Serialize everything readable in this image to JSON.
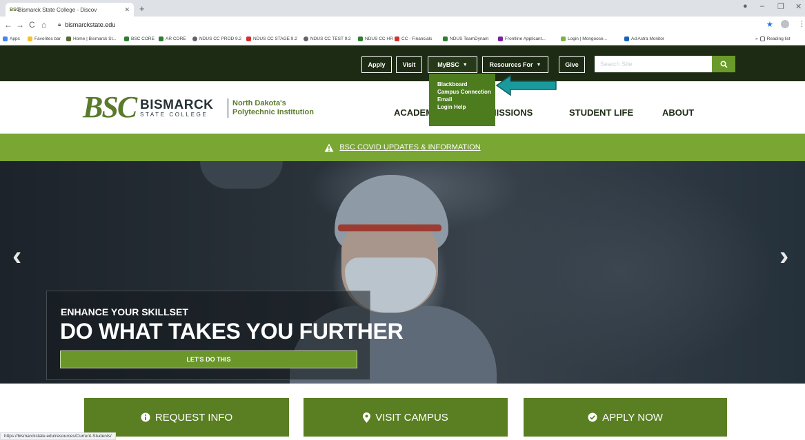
{
  "browser": {
    "tab_title": "Bismarck State College - Discov",
    "url": "bismarckstate.edu",
    "bookmarks": [
      "Apps",
      "Favorites bar",
      "Home | Bismarck St...",
      "BSC CORE",
      "AR CORE",
      "NDUS CC PROD 9.2",
      "NDUS CC STAGE 9.2",
      "NDUS CC TEST 9.2",
      "NDUS CC HR",
      "CC - Financials",
      "NDUS TeamDynam",
      "Frontline Applicant...",
      "Login | Mongoose...",
      "Ad Astra Monitor",
      "Reading list"
    ],
    "status_url": "https://bismarckstate.edu/resources/Current-Students/"
  },
  "utility_nav": {
    "apply": "Apply",
    "visit": "Visit",
    "mybsc": "MyBSC",
    "resources": "Resources For",
    "give": "Give",
    "search_placeholder": "Search Site"
  },
  "mybsc_menu": [
    "Blackboard",
    "Campus Connection",
    "Email",
    "Login Help"
  ],
  "logo": {
    "mark": "BSC",
    "name": "BISMARCK",
    "sub": "STATE COLLEGE",
    "tagline_1": "North Dakota's",
    "tagline_2": "Polytechnic Institution"
  },
  "main_nav": [
    "ACADEMICS",
    "ADMISSIONS",
    "STUDENT LIFE",
    "ABOUT"
  ],
  "alert": "BSC COVID UPDATES & INFORMATION",
  "hero": {
    "kicker": "ENHANCE YOUR SKILLSET",
    "headline": "DO WHAT TAKES YOU FURTHER",
    "cta": "LET'S DO THIS"
  },
  "ctas": [
    "REQUEST INFO",
    "VISIT CAMPUS",
    "APPLY NOW"
  ],
  "colors": {
    "dark_green": "#1d2b14",
    "brand_green": "#5a7f22",
    "alert_green": "#7aa634",
    "annotation_teal": "#1a9a9c"
  }
}
